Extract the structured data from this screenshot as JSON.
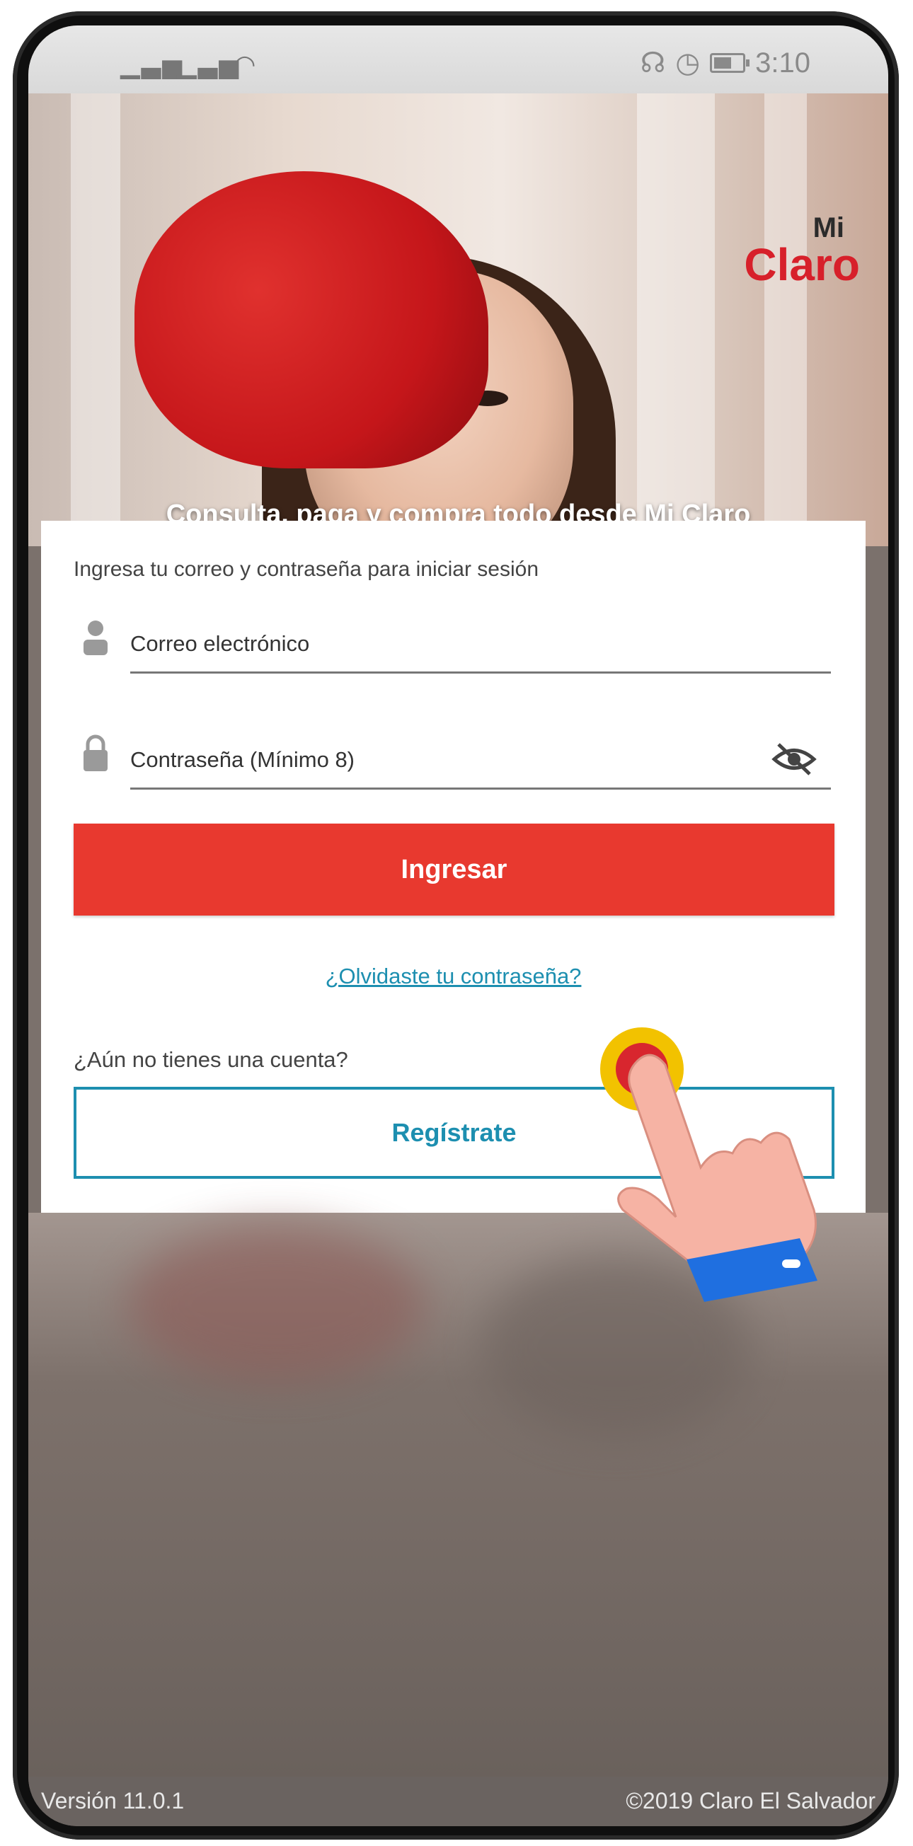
{
  "status_bar": {
    "signal_text": "ıll ıll ☰",
    "time": "3:10",
    "icons": [
      "headset-icon",
      "alarm-icon",
      "battery-icon"
    ]
  },
  "hero": {
    "logo_mi": "Mi",
    "logo_claro": "Claro",
    "tagline": "Consulta, paga y compra todo desde Mi Claro"
  },
  "login": {
    "intro": "Ingresa tu correo y contraseña para iniciar sesión",
    "email_placeholder": "Correo electrónico",
    "password_placeholder": "Contraseña (Mínimo 8)",
    "login_button": "Ingresar",
    "forgot_link": "¿Olvidaste tu contraseña?",
    "no_account": "¿Aún no tienes una cuenta?",
    "register_button": "Regístrate"
  },
  "footer": {
    "version": "Versión 11.0.1",
    "copyright": "©2019 Claro El Salvador"
  },
  "colors": {
    "brand_red": "#e8392f",
    "link_teal": "#1d8fb0",
    "logo_red": "#d7202a"
  }
}
